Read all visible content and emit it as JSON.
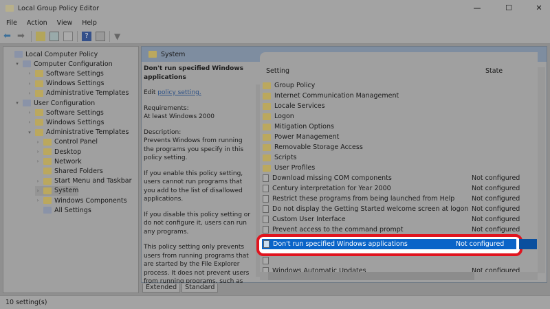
{
  "window": {
    "title": "Local Group Policy Editor",
    "minimize": "—",
    "maximize": "☐",
    "close": "✕"
  },
  "menu": [
    "File",
    "Action",
    "View",
    "Help"
  ],
  "toolbar": [
    "back-icon",
    "forward-icon",
    "up-folder-icon",
    "show-hide-tree-icon",
    "export-icon",
    "help-icon",
    "properties-icon",
    "filter-icon"
  ],
  "tree": [
    {
      "label": "Local Computer Policy",
      "level": 0,
      "icon": "policy-icon"
    },
    {
      "label": "Computer Configuration",
      "level": 1,
      "icon": "computer-icon",
      "expanded": true
    },
    {
      "label": "Software Settings",
      "level": 2,
      "icon": "folder-icon"
    },
    {
      "label": "Windows Settings",
      "level": 2,
      "icon": "folder-icon"
    },
    {
      "label": "Administrative Templates",
      "level": 2,
      "icon": "folder-icon"
    },
    {
      "label": "User Configuration",
      "level": 1,
      "icon": "user-icon",
      "expanded": true
    },
    {
      "label": "Software Settings",
      "level": 2,
      "icon": "folder-icon"
    },
    {
      "label": "Windows Settings",
      "level": 2,
      "icon": "folder-icon"
    },
    {
      "label": "Administrative Templates",
      "level": 2,
      "icon": "folder-icon",
      "expanded": true
    },
    {
      "label": "Control Panel",
      "level": 3,
      "icon": "folder-icon"
    },
    {
      "label": "Desktop",
      "level": 3,
      "icon": "folder-icon"
    },
    {
      "label": "Network",
      "level": 3,
      "icon": "folder-icon"
    },
    {
      "label": "Shared Folders",
      "level": 3,
      "icon": "folder-icon"
    },
    {
      "label": "Start Menu and Taskbar",
      "level": 3,
      "icon": "folder-icon"
    },
    {
      "label": "System",
      "level": 3,
      "icon": "folder-icon",
      "selected": true
    },
    {
      "label": "Windows Components",
      "level": 3,
      "icon": "folder-icon"
    },
    {
      "label": "All Settings",
      "level": 3,
      "icon": "settings-icon"
    }
  ],
  "header": {
    "title": "System"
  },
  "detail": {
    "title": "Don't run specified Windows applications",
    "edit_prefix": "Edit ",
    "edit_link": "policy setting.",
    "requirements_label": "Requirements:",
    "requirements": "At least Windows 2000",
    "description_label": "Description:",
    "paragraphs": [
      "Prevents Windows from running the programs you specify in this policy setting.",
      "If you enable this policy setting, users cannot run programs that you add to the list of disallowed applications.",
      "If you disable this policy setting or do not configure it, users can run any programs.",
      "This policy setting only prevents users from running programs that are started by the File Explorer process. It does not prevent users from running programs, such as"
    ]
  },
  "list": {
    "columns": {
      "setting": "Setting",
      "state": "State"
    },
    "rows": [
      {
        "name": "Group Policy",
        "type": "folder"
      },
      {
        "name": "Internet Communication Management",
        "type": "folder"
      },
      {
        "name": "Locale Services",
        "type": "folder"
      },
      {
        "name": "Logon",
        "type": "folder"
      },
      {
        "name": "Mitigation Options",
        "type": "folder"
      },
      {
        "name": "Power Management",
        "type": "folder"
      },
      {
        "name": "Removable Storage Access",
        "type": "folder"
      },
      {
        "name": "Scripts",
        "type": "folder"
      },
      {
        "name": "User Profiles",
        "type": "folder"
      },
      {
        "name": "Download missing COM components",
        "type": "setting",
        "state": "Not configured"
      },
      {
        "name": "Century interpretation for Year 2000",
        "type": "setting",
        "state": "Not configured"
      },
      {
        "name": "Restrict these programs from being launched from Help",
        "type": "setting",
        "state": "Not configured"
      },
      {
        "name": "Do not display the Getting Started welcome screen at logon",
        "type": "setting",
        "state": "Not configured"
      },
      {
        "name": "Custom User Interface",
        "type": "setting",
        "state": "Not configured"
      },
      {
        "name": "Prevent access to the command prompt",
        "type": "setting",
        "state": "Not configured"
      },
      {
        "name": "",
        "type": "setting",
        "state": ""
      },
      {
        "name": "Don't run specified Windows applications",
        "type": "setting",
        "state": "Not configured",
        "selected": true
      },
      {
        "name": "",
        "type": "setting",
        "state": ""
      },
      {
        "name": "Windows Automatic Updates",
        "type": "setting",
        "state": "Not configured"
      }
    ]
  },
  "tabs": [
    "Extended",
    "Standard"
  ],
  "status": "10 setting(s)",
  "colors": {
    "selection": "#0a64c8",
    "highlight_border": "#e0141e"
  }
}
